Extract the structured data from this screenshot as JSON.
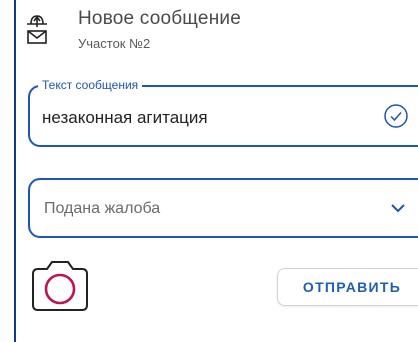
{
  "header": {
    "title": "Новое сообщение",
    "subtitle": "Участок №2",
    "icon": "ballot-envelope-icon"
  },
  "message_field": {
    "label": "Текст сообщения",
    "value": "незаконная агитация",
    "status_icon": "check-circle-icon"
  },
  "status_select": {
    "selected": "Подана жалоба",
    "icon": "chevron-down-icon"
  },
  "actions": {
    "camera_icon": "camera-icon",
    "send_label": "ОТПРАВИТЬ"
  },
  "colors": {
    "accent": "#1e56b3",
    "camera_lens": "#c0144a",
    "frame": "#0f3d86"
  }
}
